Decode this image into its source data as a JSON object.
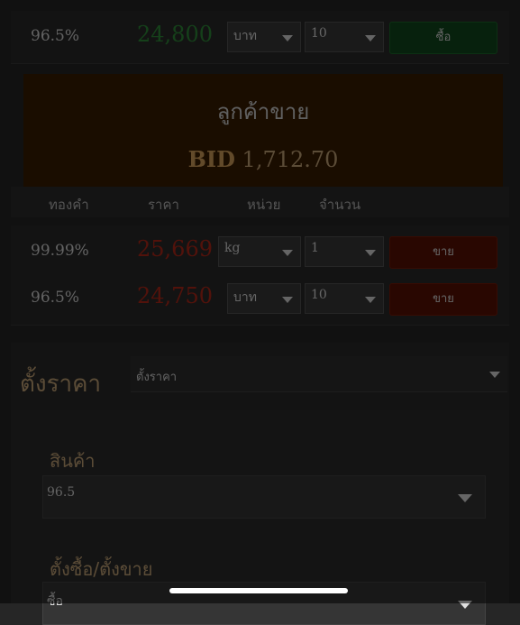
{
  "buy_row": {
    "gold": "96.5%",
    "price": "24,800",
    "unit": "บาท",
    "qty": "10",
    "button": "ซื้อ"
  },
  "bid": {
    "title": "ลูกค้าขาย",
    "label": "BID",
    "value": "1,712.70"
  },
  "table_header": {
    "gold": "ทองคำ",
    "price": "ราคา",
    "unit": "หน่วย",
    "qty": "จำนวน"
  },
  "sell_rows": [
    {
      "gold": "99.99%",
      "price": "25,669",
      "unit": "kg",
      "qty": "1",
      "button": "ขาย"
    },
    {
      "gold": "96.5%",
      "price": "24,750",
      "unit": "บาท",
      "qty": "10",
      "button": "ขาย"
    }
  ],
  "set_price": {
    "title": "ตั้งราคา",
    "select_value": "ตั้งราคา"
  },
  "form": {
    "product_label": "สินค้า",
    "product_value": "96.5",
    "action_label": "ตั้งซื้อ/ตั้งขาย",
    "action_value": "ซื้อ"
  },
  "colors": {
    "buy_price": "#2f8f3a",
    "sell_price": "#b5291a",
    "accent": "#caa87a"
  }
}
